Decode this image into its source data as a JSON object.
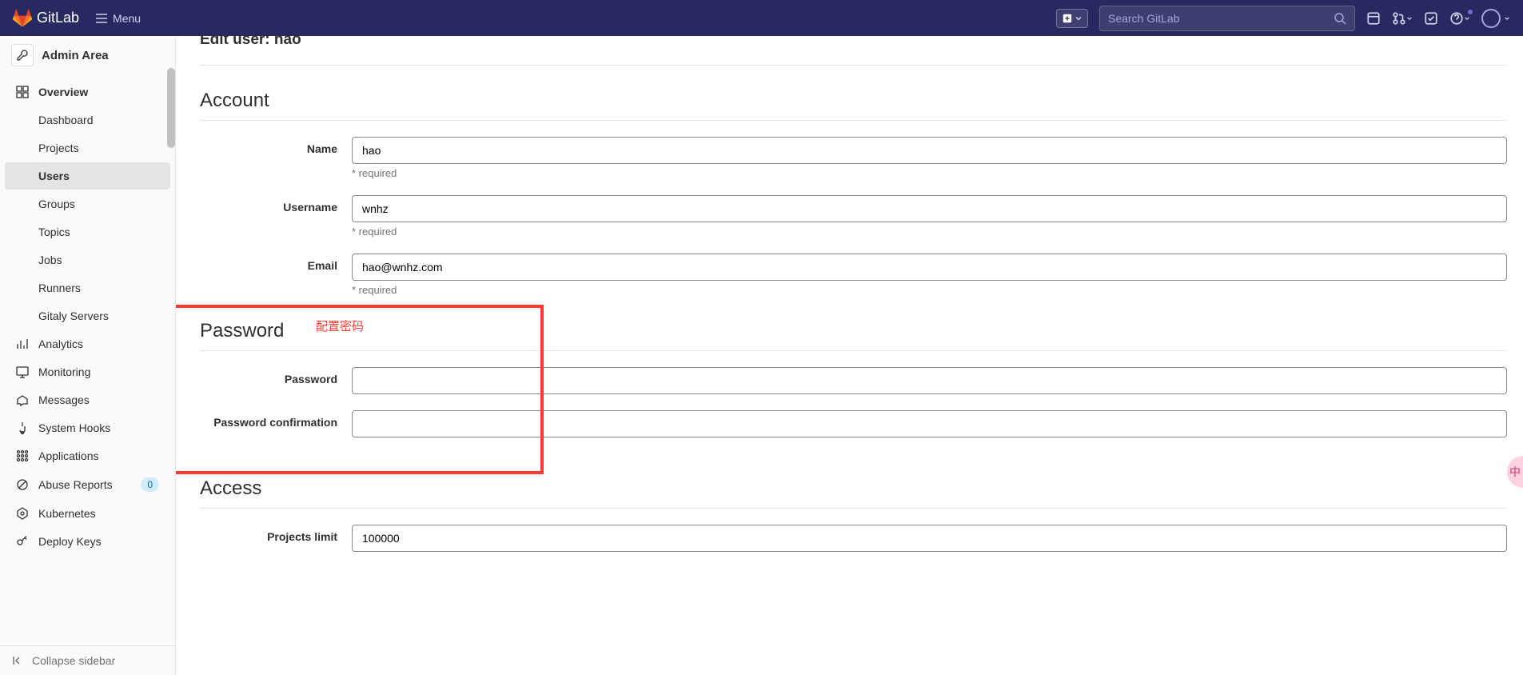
{
  "header": {
    "brand": "GitLab",
    "menu_label": "Menu",
    "search_placeholder": "Search GitLab"
  },
  "sidebar": {
    "context": "Admin Area",
    "items": [
      {
        "label": "Overview",
        "icon": "overview",
        "open": true,
        "children": [
          {
            "label": "Dashboard"
          },
          {
            "label": "Projects"
          },
          {
            "label": "Users",
            "active": true
          },
          {
            "label": "Groups"
          },
          {
            "label": "Topics"
          },
          {
            "label": "Jobs"
          },
          {
            "label": "Runners"
          },
          {
            "label": "Gitaly Servers"
          }
        ]
      },
      {
        "label": "Analytics",
        "icon": "analytics"
      },
      {
        "label": "Monitoring",
        "icon": "monitoring"
      },
      {
        "label": "Messages",
        "icon": "messages"
      },
      {
        "label": "System Hooks",
        "icon": "hooks"
      },
      {
        "label": "Applications",
        "icon": "applications"
      },
      {
        "label": "Abuse Reports",
        "icon": "abuse",
        "badge": "0"
      },
      {
        "label": "Kubernetes",
        "icon": "kubernetes"
      },
      {
        "label": "Deploy Keys",
        "icon": "key"
      }
    ],
    "collapse_label": "Collapse sidebar"
  },
  "page": {
    "title": "Edit user: hao",
    "sections": {
      "account": {
        "title": "Account",
        "name_label": "Name",
        "name_value": "hao",
        "name_help": "* required",
        "username_label": "Username",
        "username_value": "wnhz",
        "username_help": "* required",
        "email_label": "Email",
        "email_value": "hao@wnhz.com",
        "email_help": "* required"
      },
      "password": {
        "title": "Password",
        "annotation": "配置密码",
        "password_label": "Password",
        "confirm_label": "Password confirmation"
      },
      "access": {
        "title": "Access",
        "projects_limit_label": "Projects limit",
        "projects_limit_value": "100000"
      }
    }
  }
}
